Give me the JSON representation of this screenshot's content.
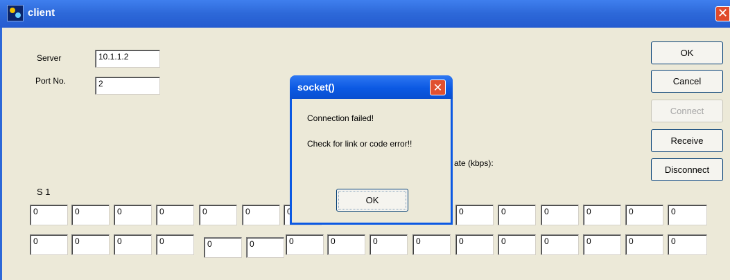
{
  "window": {
    "title": "client",
    "icon": "app-icon",
    "close_glyph": "✕"
  },
  "form": {
    "server_label": "Server",
    "server_value": "10.1.1.2",
    "port_label": "Port No.",
    "port_value": "2",
    "rate_label": "ate (kbps):",
    "section_label": "S 1"
  },
  "buttons": {
    "ok": "OK",
    "cancel": "Cancel",
    "connect": "Connect",
    "receive": "Receive",
    "disconnect": "Disconnect"
  },
  "grid": {
    "row1": [
      "0",
      "0",
      "0",
      "0",
      "0",
      "0",
      "0",
      "",
      "",
      "",
      "0",
      "0",
      "0",
      "0",
      "0",
      "0"
    ],
    "row2": [
      "0",
      "0",
      "0",
      "0",
      "0",
      "0",
      "0",
      "0",
      "0",
      "0",
      "0",
      "0",
      "0",
      "0",
      "0",
      "0"
    ]
  },
  "dialog": {
    "title": "socket()",
    "message1": "Connection failed!",
    "message2": "Check for link or code error!!",
    "ok_label": "OK",
    "close_glyph": "✕"
  }
}
